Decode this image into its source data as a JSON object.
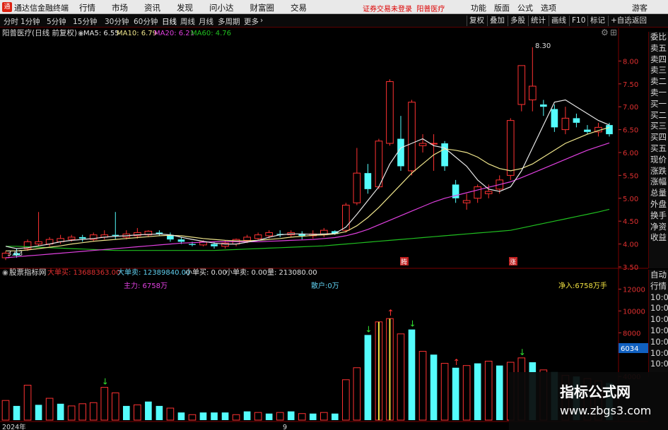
{
  "app": {
    "title": "通达信金融终端",
    "logo": "通"
  },
  "menu": [
    "行情",
    "市场",
    "资讯",
    "发现",
    "问小达",
    "财富圈",
    "交易"
  ],
  "notice": "证券交易未登录",
  "stock_name_top": "阳普医疗",
  "top_right": [
    "功能",
    "版面",
    "公式",
    "选项"
  ],
  "guest": "游客",
  "periods": [
    "分时",
    "1分钟",
    "5分钟",
    "15分钟",
    "30分钟",
    "60分钟",
    "日线",
    "周线",
    "月线",
    "多周期",
    "更多"
  ],
  "active_period": "日线",
  "right_tools": [
    "复权",
    "叠加",
    "多股",
    "统计",
    "画线",
    "F10",
    "标记",
    "+自选",
    "返回"
  ],
  "kline": {
    "stock": "阳普医疗(日线 前复权)",
    "ma": [
      {
        "label": "MA5: 6.55",
        "color": "#e6e6e6"
      },
      {
        "label": "MA10: 6.79",
        "color": "#f0e68c"
      },
      {
        "label": "MA20: 6.21",
        "color": "#e040e0"
      },
      {
        "label": "MA60: 4.76",
        "color": "#20c020"
      }
    ],
    "y_ticks": [
      "8.00",
      "7.50",
      "7.00",
      "6.50",
      "6.00",
      "5.50",
      "5.00",
      "4.50",
      "4.00",
      "3.50"
    ],
    "high_label": "8.30",
    "low_label": "3.63",
    "marks": [
      "腾",
      "涨"
    ]
  },
  "indicator": {
    "name": "股票指标网",
    "big_buy": "大单买: 13688363.00",
    "big_sell": "大单卖: 12389840.00",
    "small_buy": "小单买: 0.00",
    "small_sell": "小单卖: 0.00",
    "volume": "量: 213080.00",
    "main_force": "主力: 6758万",
    "retail": "散户:0万",
    "net_in": "净入:6758万手",
    "y_ticks": [
      "12000",
      "10000",
      "8000",
      "6034",
      "4000"
    ],
    "current": "6034"
  },
  "x_labels": [
    "2024年",
    "9"
  ],
  "side_quote": [
    "委比",
    "卖五",
    "卖四",
    "卖三",
    "卖二",
    "卖一",
    "买一",
    "买二",
    "买三",
    "买四",
    "买五",
    "现价",
    "涨跌",
    "涨幅",
    "总量",
    "外盘",
    "换手",
    "净资",
    "收益"
  ],
  "side_ticks": [
    "自动",
    "行情",
    "10:0",
    "10:0",
    "10:0",
    "10:0",
    "10:0",
    "10:0",
    "10:0",
    "10:0"
  ],
  "watermark": {
    "title": "指标公式网",
    "url": "www.zbgs3.com"
  },
  "chart_data": {
    "type": "candlestick",
    "candles": [
      [
        3.7,
        3.8,
        3.65,
        3.85
      ],
      [
        3.8,
        3.75,
        3.7,
        3.9
      ],
      [
        3.9,
        4.05,
        3.85,
        4.1
      ],
      [
        4.0,
        4.05,
        3.95,
        4.7
      ],
      [
        4.0,
        4.1,
        3.95,
        4.15
      ],
      [
        4.05,
        4.12,
        4.0,
        4.2
      ],
      [
        4.1,
        4.15,
        4.05,
        4.2
      ],
      [
        4.15,
        4.12,
        4.05,
        4.2
      ],
      [
        4.1,
        4.2,
        4.05,
        4.25
      ],
      [
        4.15,
        4.2,
        4.1,
        4.3
      ],
      [
        4.2,
        4.18,
        4.1,
        4.7
      ],
      [
        4.15,
        4.22,
        4.1,
        4.3
      ],
      [
        4.18,
        4.25,
        4.12,
        4.35
      ],
      [
        4.2,
        4.28,
        4.15,
        4.3
      ],
      [
        4.25,
        4.22,
        4.18,
        4.3
      ],
      [
        4.2,
        4.1,
        4.05,
        4.25
      ],
      [
        4.1,
        4.05,
        4.0,
        4.15
      ],
      [
        4.0,
        3.98,
        3.95,
        4.05
      ],
      [
        3.98,
        4.05,
        3.95,
        4.08
      ],
      [
        4.0,
        3.95,
        3.9,
        4.05
      ],
      [
        3.95,
        4.02,
        3.9,
        4.08
      ],
      [
        4.0,
        4.1,
        3.95,
        4.12
      ],
      [
        4.08,
        4.15,
        4.02,
        4.2
      ],
      [
        4.12,
        4.2,
        4.08,
        4.25
      ],
      [
        4.18,
        4.25,
        4.12,
        4.3
      ],
      [
        4.22,
        4.2,
        4.15,
        4.3
      ],
      [
        4.2,
        4.25,
        4.15,
        4.3
      ],
      [
        4.22,
        4.18,
        4.1,
        4.28
      ],
      [
        4.18,
        4.22,
        4.12,
        4.3
      ],
      [
        4.2,
        4.3,
        4.15,
        4.35
      ],
      [
        4.28,
        4.22,
        4.2,
        4.3
      ],
      [
        4.3,
        4.85,
        4.25,
        4.9
      ],
      [
        4.9,
        5.55,
        4.85,
        6.1
      ],
      [
        5.55,
        5.2,
        5.1,
        5.75
      ],
      [
        5.25,
        6.25,
        5.2,
        6.3
      ],
      [
        6.2,
        7.55,
        6.15,
        7.6
      ],
      [
        6.3,
        5.7,
        5.6,
        6.8
      ],
      [
        5.6,
        7.1,
        5.5,
        7.15
      ],
      [
        6.15,
        6.2,
        6.0,
        6.4
      ],
      [
        6.2,
        6.2,
        5.6,
        6.4
      ],
      [
        6.2,
        5.7,
        5.6,
        6.25
      ],
      [
        5.3,
        5.0,
        4.9,
        5.4
      ],
      [
        4.9,
        4.95,
        4.75,
        5.1
      ],
      [
        5.0,
        5.25,
        4.9,
        5.3
      ],
      [
        5.1,
        5.15,
        5.0,
        5.3
      ],
      [
        5.2,
        5.4,
        5.1,
        5.5
      ],
      [
        5.5,
        6.7,
        5.4,
        6.75
      ],
      [
        7.05,
        7.9,
        6.9,
        7.9
      ],
      [
        7.15,
        7.45,
        6.9,
        8.3
      ],
      [
        7.05,
        7.0,
        6.8,
        7.15
      ],
      [
        6.95,
        6.55,
        6.45,
        7.05
      ],
      [
        6.5,
        6.75,
        6.4,
        7.0
      ],
      [
        6.75,
        6.65,
        6.55,
        6.85
      ],
      [
        6.5,
        6.45,
        6.4,
        6.6
      ],
      [
        6.45,
        6.55,
        6.35,
        6.65
      ],
      [
        6.6,
        6.4,
        6.35,
        6.65
      ]
    ],
    "ma5": [
      3.95,
      3.9,
      3.92,
      3.96,
      4.0,
      4.05,
      4.08,
      4.1,
      4.12,
      4.15,
      4.17,
      4.18,
      4.2,
      4.21,
      4.22,
      4.2,
      4.15,
      4.1,
      4.06,
      4.02,
      4.0,
      4.0,
      4.04,
      4.08,
      4.15,
      4.2,
      4.22,
      4.22,
      4.21,
      4.22,
      4.23,
      4.37,
      4.65,
      4.95,
      5.25,
      5.75,
      6.1,
      6.2,
      6.3,
      6.15,
      6.1,
      5.9,
      5.7,
      5.4,
      5.2,
      5.15,
      5.25,
      5.6,
      6.1,
      6.6,
      7.1,
      7.15,
      7.0,
      6.85,
      6.7,
      6.6
    ],
    "ma10": [
      3.85,
      3.85,
      3.87,
      3.9,
      3.93,
      3.96,
      4.0,
      4.03,
      4.06,
      4.08,
      4.1,
      4.12,
      4.14,
      4.16,
      4.18,
      4.19,
      4.18,
      4.15,
      4.12,
      4.1,
      4.08,
      4.07,
      4.07,
      4.08,
      4.1,
      4.12,
      4.15,
      4.17,
      4.19,
      4.2,
      4.22,
      4.27,
      4.4,
      4.58,
      4.8,
      5.05,
      5.3,
      5.55,
      5.75,
      5.95,
      6.08,
      6.05,
      6.0,
      5.9,
      5.75,
      5.65,
      5.6,
      5.65,
      5.75,
      5.9,
      6.05,
      6.2,
      6.3,
      6.4,
      6.48,
      6.55
    ],
    "ma20": [
      3.7,
      3.72,
      3.74,
      3.76,
      3.78,
      3.8,
      3.82,
      3.84,
      3.86,
      3.88,
      3.9,
      3.92,
      3.94,
      3.96,
      3.98,
      4.0,
      4.02,
      4.03,
      4.04,
      4.05,
      4.05,
      4.05,
      4.05,
      4.05,
      4.06,
      4.07,
      4.08,
      4.09,
      4.1,
      4.12,
      4.14,
      4.18,
      4.24,
      4.32,
      4.42,
      4.52,
      4.62,
      4.72,
      4.82,
      4.92,
      5.0,
      5.06,
      5.12,
      5.18,
      5.24,
      5.3,
      5.36,
      5.45,
      5.55,
      5.65,
      5.75,
      5.85,
      5.95,
      6.05,
      6.13,
      6.21
    ],
    "ma60": [
      3.95,
      3.95,
      3.94,
      3.93,
      3.92,
      3.91,
      3.9,
      3.89,
      3.88,
      3.87,
      3.86,
      3.86,
      3.86,
      3.86,
      3.86,
      3.86,
      3.86,
      3.86,
      3.86,
      3.86,
      3.87,
      3.88,
      3.89,
      3.9,
      3.91,
      3.92,
      3.93,
      3.94,
      3.95,
      3.96,
      3.98,
      4.0,
      4.02,
      4.04,
      4.06,
      4.08,
      4.1,
      4.12,
      4.14,
      4.16,
      4.18,
      4.2,
      4.22,
      4.24,
      4.26,
      4.28,
      4.3,
      4.35,
      4.4,
      4.45,
      4.5,
      4.55,
      4.6,
      4.65,
      4.7,
      4.76
    ],
    "volume": [
      1800,
      1300,
      3200,
      1400,
      2000,
      1500,
      1300,
      1500,
      1600,
      3000,
      2500,
      1300,
      1400,
      1700,
      1300,
      1100,
      700,
      500,
      700,
      700,
      700,
      500,
      800,
      700,
      600,
      700,
      800,
      600,
      600,
      700,
      600,
      3700,
      4800,
      7800,
      9000,
      9300,
      7900,
      8300,
      6300,
      6000,
      5200,
      4800,
      5000,
      5200,
      5400,
      5000,
      5300,
      5700,
      5300,
      4600,
      4400,
      4100,
      4000,
      3800,
      3600,
      3400
    ],
    "volume_color": [
      "r",
      "c",
      "r",
      "c",
      "r",
      "c",
      "r",
      "r",
      "r",
      "r",
      "r",
      "c",
      "r",
      "c",
      "c",
      "r",
      "c",
      "r",
      "c",
      "c",
      "c",
      "r",
      "c",
      "r",
      "c",
      "r",
      "c",
      "r",
      "c",
      "r",
      "c",
      "r",
      "r",
      "c",
      "y",
      "y",
      "r",
      "c",
      "r",
      "c",
      "r",
      "c",
      "r",
      "c",
      "r",
      "c",
      "r",
      "r",
      "c",
      "r",
      "c",
      "r",
      "c",
      "r",
      "r",
      "c"
    ],
    "ylim_price": [
      3.5,
      8.5
    ],
    "ylim_volume": [
      0,
      13000
    ]
  }
}
